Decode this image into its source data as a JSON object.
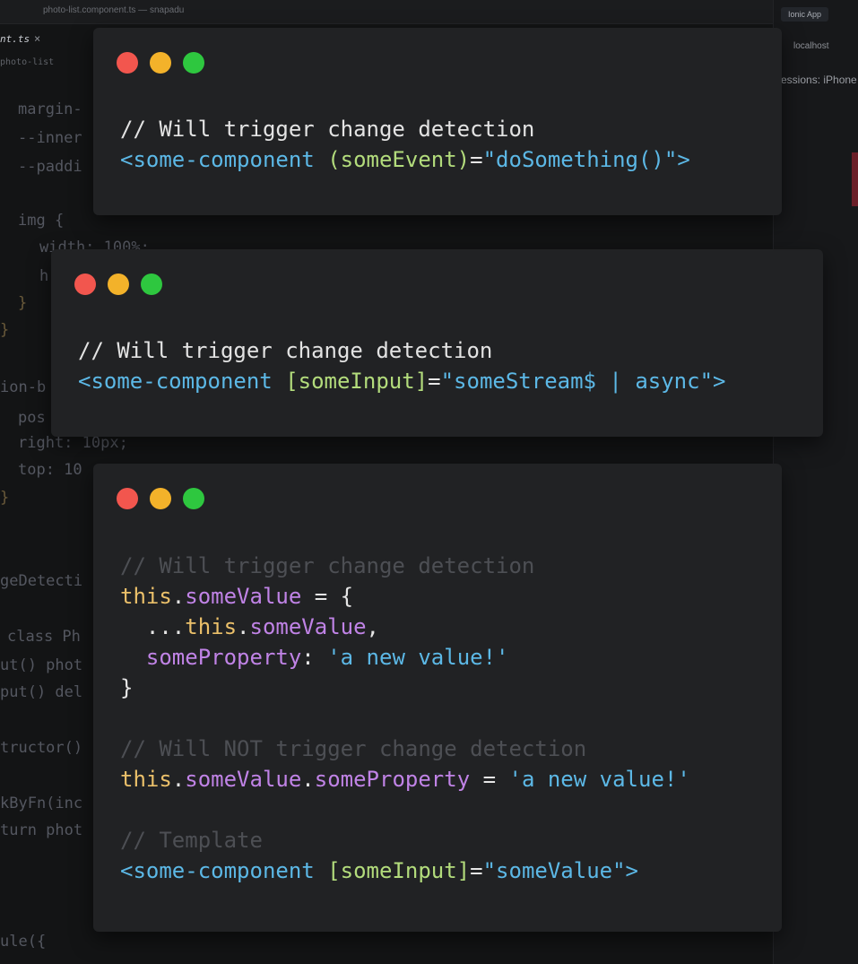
{
  "background_editor": {
    "window_title": "photo-list.component.ts — snapadu",
    "tab": {
      "label": "nt.ts",
      "close": "×"
    },
    "breadcrumb": "photo-list",
    "lines": [
      "margin-",
      "--inner",
      "--paddi",
      "img {",
      "width: 100%;",
      "h",
      "}",
      "}",
      "ion-b",
      "pos",
      "right: 10px;",
      "top: 10",
      "}",
      "geDetecti",
      "class Ph",
      "ut() phot",
      "put() del",
      "tructor()",
      "kByFn(inc",
      "turn phot",
      "ule({"
    ],
    "browser": {
      "tab_label": "Ionic App",
      "url": "localhost",
      "sessions": "essions: iPhone"
    }
  },
  "cards": [
    {
      "name": "card-event-binding",
      "lines": [
        [
          {
            "t": "// Will trigger change detection",
            "c": "c-comment"
          }
        ],
        [
          {
            "t": "<some-component ",
            "c": "c-tag"
          },
          {
            "t": "(someEvent)",
            "c": "c-attr"
          },
          {
            "t": "=",
            "c": "c-white"
          },
          {
            "t": "\"doSomething()\">",
            "c": "c-str"
          }
        ]
      ]
    },
    {
      "name": "card-async-pipe",
      "lines": [
        [
          {
            "t": "// Will trigger change detection",
            "c": "c-comment"
          }
        ],
        [
          {
            "t": "<some-component ",
            "c": "c-tag"
          },
          {
            "t": "[someInput]",
            "c": "c-attr"
          },
          {
            "t": "=",
            "c": "c-white"
          },
          {
            "t": "\"someStream$ | async\">",
            "c": "c-str"
          }
        ]
      ]
    },
    {
      "name": "card-object-mutation",
      "lines": [
        [
          {
            "t": "// Will trigger change detection",
            "c": "c-comment-dim"
          }
        ],
        [
          {
            "t": "this",
            "c": "c-kw"
          },
          {
            "t": ".",
            "c": "c-white"
          },
          {
            "t": "someValue",
            "c": "c-prop"
          },
          {
            "t": " = {",
            "c": "c-white"
          }
        ],
        [
          {
            "t": "  ...",
            "c": "c-white"
          },
          {
            "t": "this",
            "c": "c-kw"
          },
          {
            "t": ".",
            "c": "c-white"
          },
          {
            "t": "someValue",
            "c": "c-prop"
          },
          {
            "t": ",",
            "c": "c-white"
          }
        ],
        [
          {
            "t": "  someProperty",
            "c": "c-prop"
          },
          {
            "t": ": ",
            "c": "c-white"
          },
          {
            "t": "'a new value!'",
            "c": "c-str"
          }
        ],
        [
          {
            "t": "}",
            "c": "c-white"
          }
        ],
        [
          {
            "t": "",
            "c": "c-white"
          }
        ],
        [
          {
            "t": "// Will NOT trigger change detection",
            "c": "c-comment-dim"
          }
        ],
        [
          {
            "t": "this",
            "c": "c-kw"
          },
          {
            "t": ".",
            "c": "c-white"
          },
          {
            "t": "someValue",
            "c": "c-prop"
          },
          {
            "t": ".",
            "c": "c-white"
          },
          {
            "t": "someProperty",
            "c": "c-prop"
          },
          {
            "t": " = ",
            "c": "c-white"
          },
          {
            "t": "'a new value!'",
            "c": "c-str"
          }
        ],
        [
          {
            "t": "",
            "c": "c-white"
          }
        ],
        [
          {
            "t": "// Template",
            "c": "c-comment-dim"
          }
        ],
        [
          {
            "t": "<some-component ",
            "c": "c-tag"
          },
          {
            "t": "[someInput]",
            "c": "c-attr"
          },
          {
            "t": "=",
            "c": "c-white"
          },
          {
            "t": "\"someValue\">",
            "c": "c-str"
          }
        ]
      ]
    }
  ],
  "colors": {
    "card_bg": "#212224",
    "dot_red": "#f2564e",
    "dot_yellow": "#f3b22a",
    "dot_green": "#2ec73f",
    "tag": "#5cb8e6",
    "attr": "#b3dc7c",
    "keyword": "#ebc06a",
    "property": "#c083e6"
  }
}
